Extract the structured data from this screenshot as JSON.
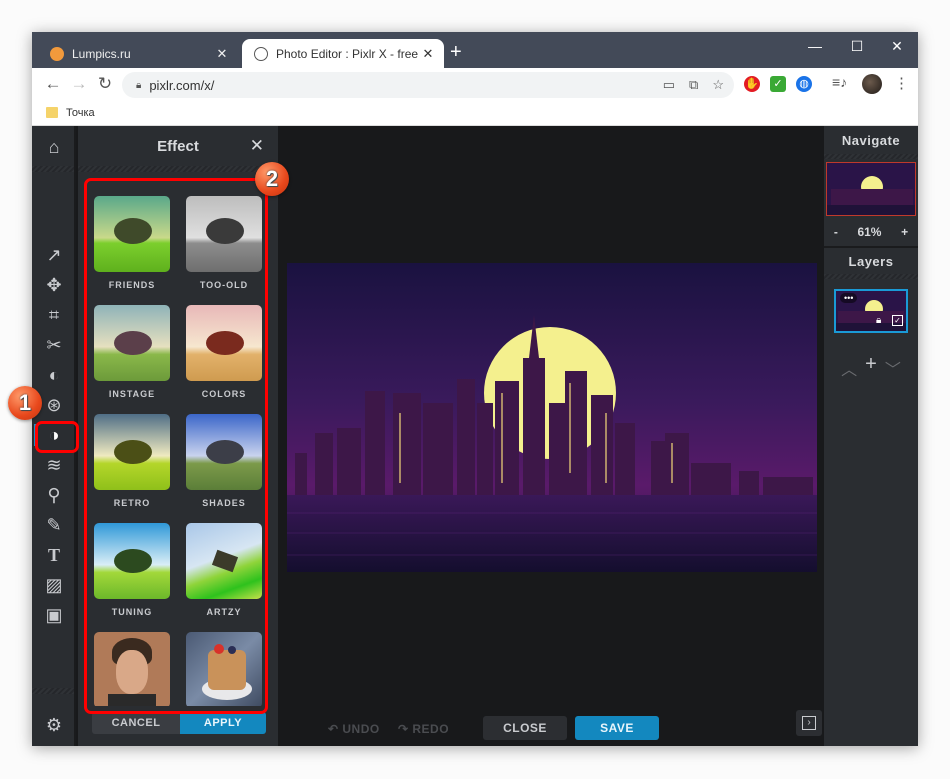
{
  "browser": {
    "tabs": [
      {
        "label": "Lumpics.ru",
        "active": false
      },
      {
        "label": "Photo Editor : Pixlr X - free image",
        "active": true
      }
    ],
    "new_tab": "+",
    "window_controls": {
      "minimize": "—",
      "maximize": "☐",
      "close": "✕"
    },
    "url": "pixlr.com/x/",
    "bookmarks": [
      {
        "label": "Точка"
      }
    ],
    "extensions": [
      {
        "name": "adblock",
        "color": "#e31b23",
        "glyph": "✋"
      },
      {
        "name": "check",
        "color": "#3aa935",
        "glyph": "✓"
      },
      {
        "name": "vpn-globe",
        "color": "#1a73e8",
        "glyph": "◍"
      }
    ]
  },
  "app": {
    "tools": [
      {
        "name": "home",
        "glyph": "⌂"
      },
      {
        "name": "arrange",
        "glyph": "↗"
      },
      {
        "name": "move",
        "glyph": "✥"
      },
      {
        "name": "crop",
        "glyph": "⌗"
      },
      {
        "name": "cutout",
        "glyph": "✂"
      },
      {
        "name": "adjust",
        "glyph": "◐"
      },
      {
        "name": "filter",
        "glyph": "⊛"
      },
      {
        "name": "effect",
        "glyph": "◑",
        "active": true
      },
      {
        "name": "liquify",
        "glyph": "≋"
      },
      {
        "name": "retouch",
        "glyph": "⚲"
      },
      {
        "name": "draw",
        "glyph": "✎"
      },
      {
        "name": "text",
        "glyph": "T"
      },
      {
        "name": "elements",
        "glyph": "▨"
      },
      {
        "name": "add-image",
        "glyph": "▣"
      },
      {
        "name": "settings",
        "glyph": "⚙"
      }
    ],
    "effect_panel": {
      "title": "Effect",
      "close": "✕",
      "effects": [
        {
          "label": "FRIENDS"
        },
        {
          "label": "TOO-OLD"
        },
        {
          "label": "INSTAGE"
        },
        {
          "label": "COLORS"
        },
        {
          "label": "RETRO"
        },
        {
          "label": "SHADES"
        },
        {
          "label": "TUNING"
        },
        {
          "label": "ARTZY"
        },
        {
          "label": ""
        },
        {
          "label": ""
        }
      ],
      "cancel": "CANCEL",
      "apply": "APPLY"
    },
    "bottom_bar": {
      "undo": "UNDO",
      "redo": "REDO",
      "close": "CLOSE",
      "save": "SAVE"
    },
    "navigate": {
      "title": "Navigate",
      "zoom_out": "-",
      "zoom_level": "61%",
      "zoom_in": "+"
    },
    "layers": {
      "title": "Layers",
      "more": "•••",
      "up": "︿",
      "add": "+",
      "down": "﹀"
    }
  },
  "annotations": [
    {
      "number": "1",
      "target": "effect-tool"
    },
    {
      "number": "2",
      "target": "effect-thumbnails"
    }
  ],
  "colors": {
    "accent": "#1388bf",
    "panel": "#2a2d31",
    "canvas_bg": "#18191b",
    "annotation": "#ff0000"
  }
}
